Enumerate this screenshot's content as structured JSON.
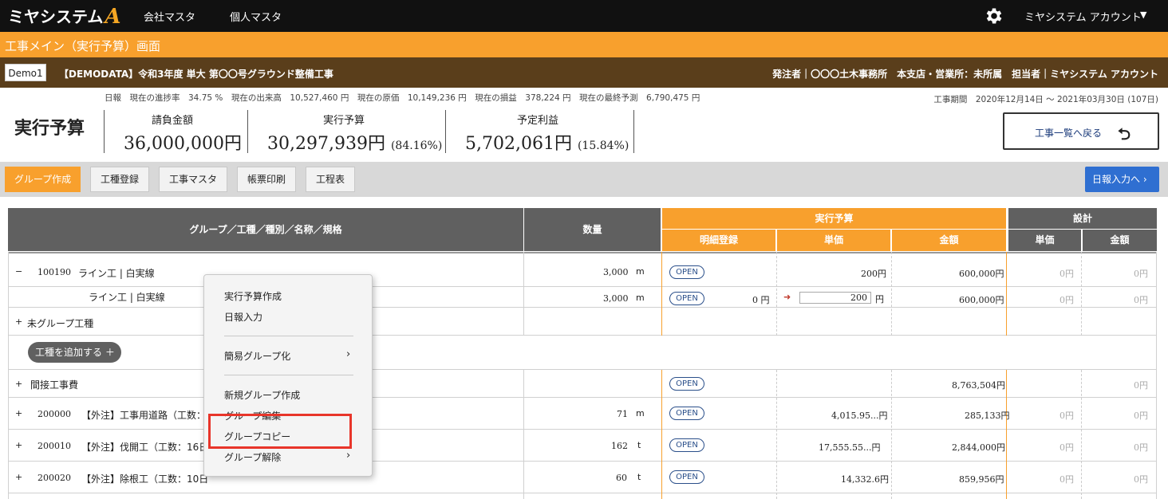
{
  "topnav": {
    "logo_text": "ミヤシステム",
    "logo_mark": "A",
    "links": [
      "会社マスタ",
      "個人マスタ"
    ],
    "account": "ミヤシステム アカウント",
    "gear_icon": "gear-icon",
    "caret": "▼"
  },
  "screen_title": "工事メイン（実行予算）画面",
  "project": {
    "code": "Demo1",
    "name": "【DEMODATA】令和3年度 単大 第〇〇号グラウンド整備工事",
    "right_info": "発注者｜〇〇〇土木事務所　本支店・営業所：未所属　担当者｜ミヤシステム アカウント"
  },
  "status_line": "日報　現在の進捗率　34.75 %　現在の出来高　10,527,460 円　現在の原価　10,149,236 円　現在の損益　378,224 円　現在の最終予測　6,790,475 円",
  "period": "工事期間　2020年12月14日 ～ 2021年03月30日 (107日)",
  "summary": {
    "title": "実行予算",
    "contract_label": "請負金額",
    "contract_value": "36,000,000円",
    "budget_label": "実行予算",
    "budget_value": "30,297,939円",
    "budget_pct": "(84.16%)",
    "profit_label": "予定利益",
    "profit_value": "5,702,061円",
    "profit_pct": "(15.84%)"
  },
  "back_button": "工事一覧へ戻る",
  "toolbar": {
    "buttons": [
      "グループ作成",
      "工種登録",
      "工事マスタ",
      "帳票印刷",
      "工程表"
    ],
    "report_button": "日報入力へ ›"
  },
  "table": {
    "headers": {
      "name": "グループ／工種／種別／名称／規格",
      "qty": "数量",
      "budget_group": "実行予算",
      "detail": "明細登録",
      "unit_price": "単価",
      "amount": "金額",
      "design_group": "設計",
      "design_unit": "単価",
      "design_amount": "金額"
    },
    "open_label": "OPEN",
    "rows": [
      {
        "toggle": "−",
        "code": "100190",
        "name": "ライン工 | 白実線",
        "qty": "3,000",
        "unit": "m",
        "detail_amount": "",
        "unit_price": "200円",
        "amount": "600,000円",
        "d_unit": "0円",
        "d_amount": "0円"
      },
      {
        "toggle": "",
        "code": "",
        "name": "ライン工 | 白実線",
        "qty": "3,000",
        "unit": "m",
        "detail_amount": "0 円",
        "unit_price_input": "200",
        "unit_suffix": "円",
        "amount": "600,000円",
        "d_unit": "0円",
        "d_amount": "0円"
      },
      {
        "toggle": "+",
        "code": "",
        "name": "未グループ工種"
      },
      {
        "add_button": "工種を追加する ＋"
      },
      {
        "toggle": "+",
        "code": "",
        "name": "間接工事費",
        "amount": "8,763,504円",
        "d_amount": "0円"
      },
      {
        "toggle": "+",
        "code": "200000",
        "name": "【外注】工事用道路（工数：",
        "qty": "71",
        "unit": "m",
        "unit_price": "4,015.95...円",
        "amount": "285,133円",
        "d_unit": "0円",
        "d_amount": "0円"
      },
      {
        "toggle": "+",
        "code": "200010",
        "name": "【外注】伐開工（工数：16日",
        "qty": "162",
        "unit": "t",
        "unit_price": "17,555.55...円",
        "amount": "2,844,000円",
        "d_unit": "0円",
        "d_amount": "0円"
      },
      {
        "toggle": "+",
        "code": "200020",
        "name": "【外注】除根工（工数：10日",
        "qty": "60",
        "unit": "t",
        "unit_price": "14,332.6円",
        "amount": "859,956円",
        "d_unit": "0円",
        "d_amount": "0円"
      }
    ]
  },
  "context_menu": {
    "items": [
      "実行予算作成",
      "日報入力",
      "簡易グループ化",
      "新規グループ作成",
      "グループ編集",
      "グループコピー",
      "グループ解除"
    ],
    "highlighted": "グループコピー"
  }
}
